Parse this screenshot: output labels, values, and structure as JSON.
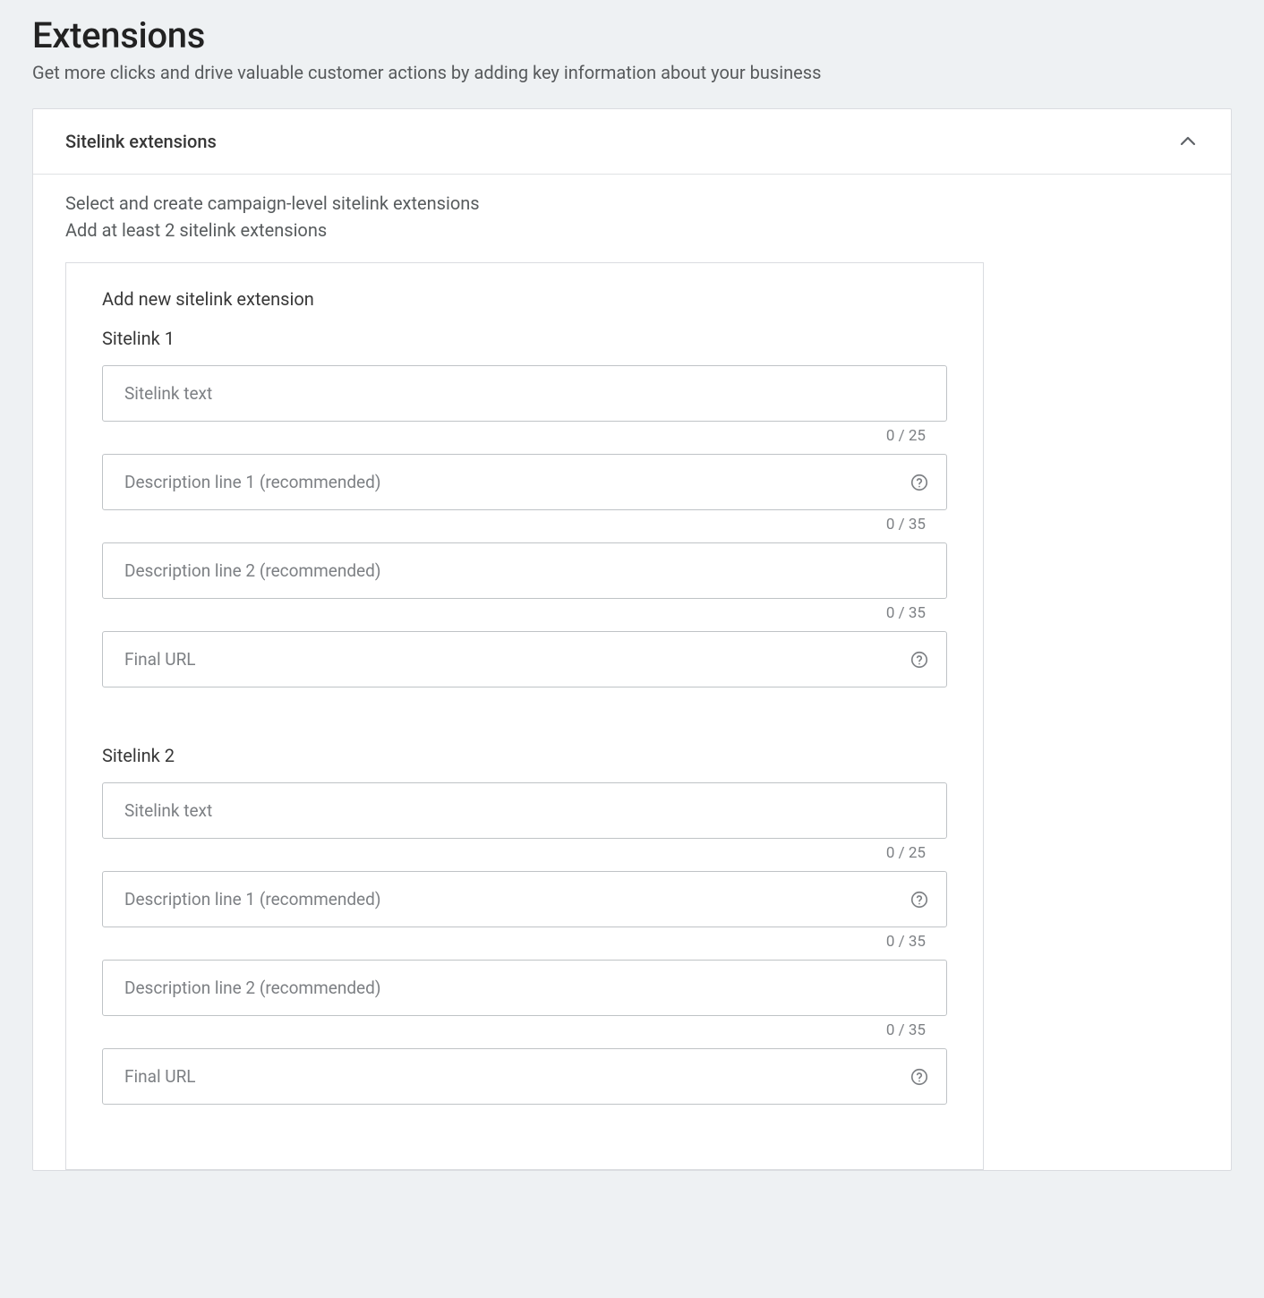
{
  "page": {
    "title": "Extensions",
    "subtitle": "Get more clicks and drive valuable customer actions by adding key information about your business"
  },
  "panel": {
    "title": "Sitelink extensions",
    "lead1": "Select and create campaign-level sitelink extensions",
    "lead2": "Add at least 2 sitelink extensions",
    "inner_title": "Add new sitelink extension"
  },
  "placeholders": {
    "sitelink_text": "Sitelink text",
    "desc1": "Description line 1 (recommended)",
    "desc2": "Description line 2 (recommended)",
    "final_url": "Final URL"
  },
  "counters": {
    "text": "0 / 25",
    "desc1": "0 / 35",
    "desc2": "0 / 35"
  },
  "sitelinks": [
    {
      "heading": "Sitelink 1"
    },
    {
      "heading": "Sitelink 2"
    }
  ]
}
